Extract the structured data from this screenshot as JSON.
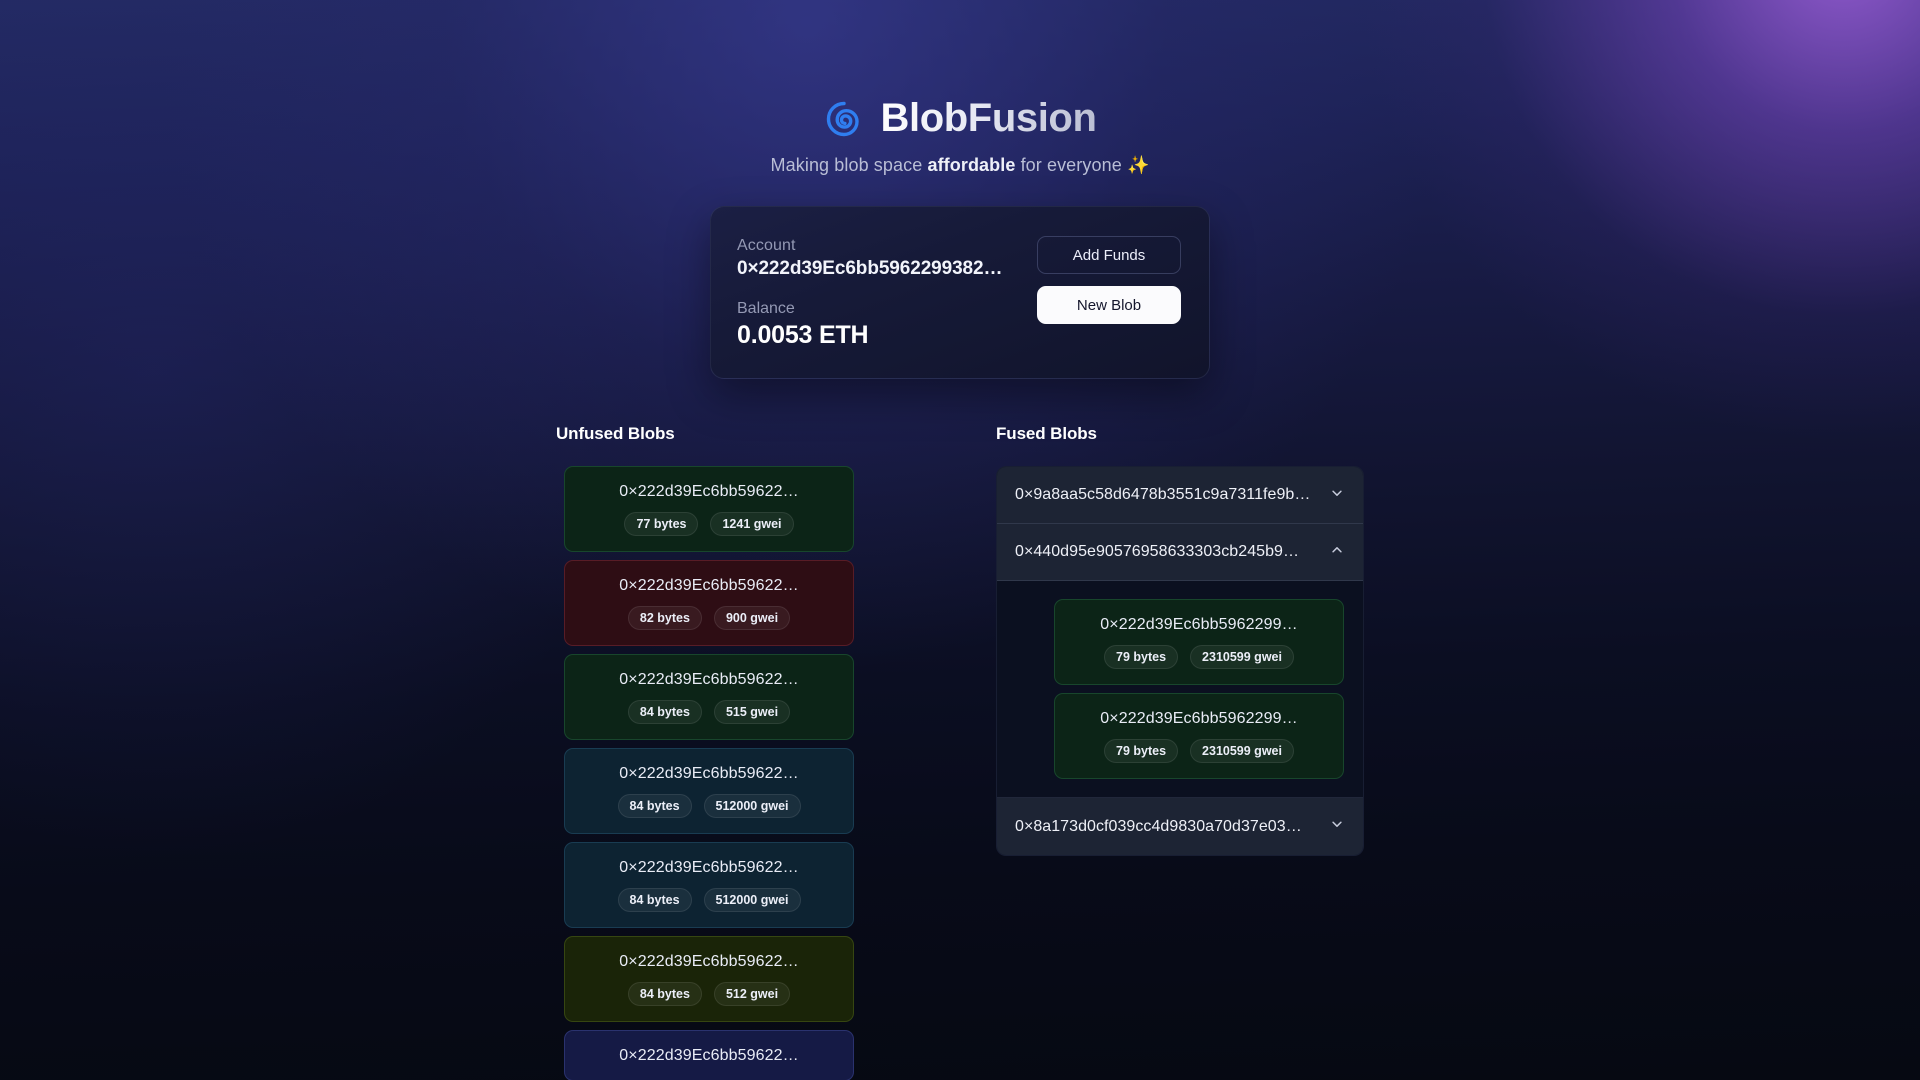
{
  "app": {
    "brand_name": "BlobFusion",
    "logo_icon": "spiral-icon",
    "tagline_prefix": "Making blob space ",
    "tagline_emphasis": "affordable",
    "tagline_suffix": " for everyone ",
    "tagline_sparkle": "✨",
    "accent_color": "#2f7ef0",
    "background_glow_color": "#8a5cd2"
  },
  "account": {
    "account_label": "Account",
    "account_value": "0×222d39Ec6bb5962299382…",
    "balance_label": "Balance",
    "balance_value": "0.0053 ETH",
    "add_funds_label": "Add Funds",
    "new_blob_label": "New Blob"
  },
  "unfused": {
    "title": "Unfused Blobs",
    "blobs": [
      {
        "hash": "0×222d39Ec6bb59622…",
        "size": "77 bytes",
        "price": "1241 gwei",
        "color": "green"
      },
      {
        "hash": "0×222d39Ec6bb59622…",
        "size": "82 bytes",
        "price": "900 gwei",
        "color": "red"
      },
      {
        "hash": "0×222d39Ec6bb59622…",
        "size": "84 bytes",
        "price": "515 gwei",
        "color": "green"
      },
      {
        "hash": "0×222d39Ec6bb59622…",
        "size": "84 bytes",
        "price": "512000 gwei",
        "color": "teal"
      },
      {
        "hash": "0×222d39Ec6bb59622…",
        "size": "84 bytes",
        "price": "512000 gwei",
        "color": "teal"
      },
      {
        "hash": "0×222d39Ec6bb59622…",
        "size": "84 bytes",
        "price": "512 gwei",
        "color": "olive"
      },
      {
        "hash": "0×222d39Ec6bb59622…",
        "size": "",
        "price": "",
        "color": "indigo"
      }
    ]
  },
  "fused": {
    "title": "Fused Blobs",
    "groups": [
      {
        "hash": "0×9a8aa5c58d6478b3551c9a7311fe9b…",
        "expanded": false,
        "chevron": "chevron-down-icon",
        "children": []
      },
      {
        "hash": "0×440d95e90576958633303cb245b9…",
        "expanded": true,
        "chevron": "chevron-up-icon",
        "children": [
          {
            "hash": "0×222d39Ec6bb5962299…",
            "size": "79 bytes",
            "price": "2310599 gwei",
            "color": "green"
          },
          {
            "hash": "0×222d39Ec6bb5962299…",
            "size": "79 bytes",
            "price": "2310599 gwei",
            "color": "green"
          }
        ]
      },
      {
        "hash": "0×8a173d0cf039cc4d9830a70d37e03…",
        "expanded": false,
        "chevron": "chevron-down-icon",
        "children": []
      }
    ]
  }
}
